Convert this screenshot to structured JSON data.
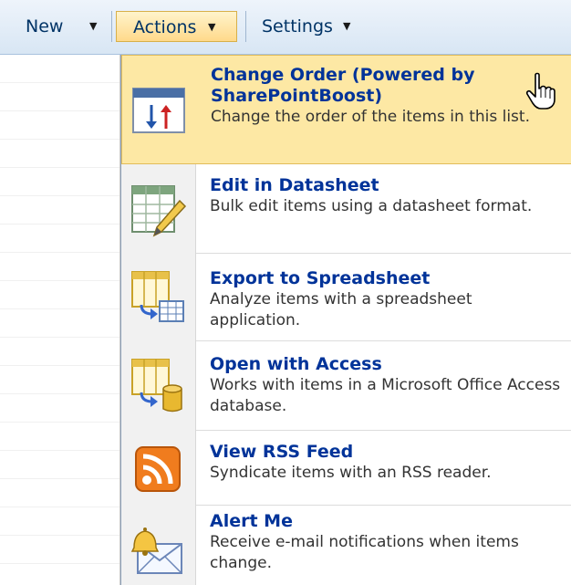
{
  "toolbar": {
    "new_label": "New",
    "actions_label": "Actions",
    "settings_label": "Settings",
    "dropdown_glyph": "▼"
  },
  "menu": {
    "items": [
      {
        "title": "Change Order (Powered by SharePointBoost)",
        "description": "Change the order of the items in this list.",
        "icon": "change-order-icon",
        "highlighted": true
      },
      {
        "title": "Edit in Datasheet",
        "description": "Bulk edit items using a datasheet format.",
        "icon": "datasheet-edit-icon"
      },
      {
        "title": "Export to Spreadsheet",
        "description": "Analyze items with a spreadsheet application.",
        "icon": "export-spreadsheet-icon"
      },
      {
        "title": "Open with Access",
        "description": "Works with items in a Microsoft Office Access database.",
        "icon": "access-database-icon"
      },
      {
        "title": "View RSS Feed",
        "description": "Syndicate items with an RSS reader.",
        "icon": "rss-icon"
      },
      {
        "title": "Alert Me",
        "description": "Receive e-mail notifications when items change.",
        "icon": "alert-envelope-icon"
      }
    ]
  },
  "colors": {
    "highlight": "#fde8a4",
    "title_text": "#003399",
    "toolbar_text": "#003366"
  }
}
